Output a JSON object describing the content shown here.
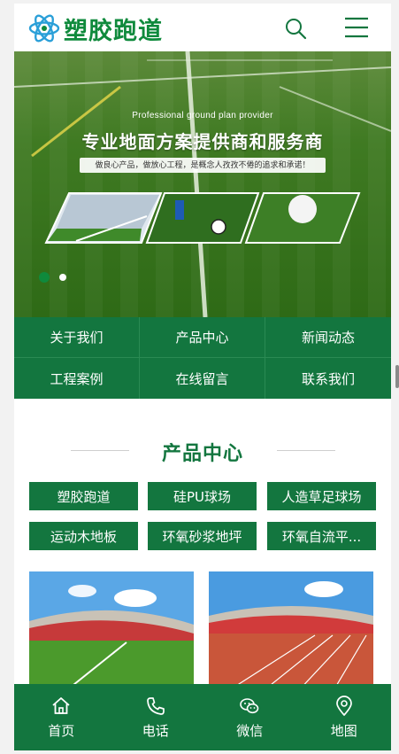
{
  "header": {
    "logo_text": "塑胶跑道",
    "search_icon": "search-icon",
    "menu_icon": "hamburger-menu-icon"
  },
  "banner": {
    "subtitle": "Professional ground plan provider",
    "title": "专业地面方案提供商和服务商",
    "slogan": "做良心产品，做放心工程，是概念人孜孜不倦的追求和承诺！",
    "active_slide": 1,
    "slide_count": 2
  },
  "nav": {
    "items": [
      {
        "label": "关于我们"
      },
      {
        "label": "产品中心"
      },
      {
        "label": "新闻动态"
      },
      {
        "label": "工程案例"
      },
      {
        "label": "在线留言"
      },
      {
        "label": "联系我们"
      }
    ]
  },
  "products": {
    "title": "产品中心",
    "categories": [
      {
        "label": "塑胶跑道"
      },
      {
        "label": "硅PU球场"
      },
      {
        "label": "人造草足球场"
      },
      {
        "label": "运动木地板"
      },
      {
        "label": "环氧砂浆地坪"
      },
      {
        "label": "环氧自流平..."
      }
    ]
  },
  "bottom_bar": {
    "items": [
      {
        "label": "首页",
        "icon": "home-icon"
      },
      {
        "label": "电话",
        "icon": "phone-icon"
      },
      {
        "label": "微信",
        "icon": "wechat-icon"
      },
      {
        "label": "地图",
        "icon": "map-pin-icon"
      }
    ]
  },
  "colors": {
    "brand_green": "#13763f",
    "logo_green": "#0f8a3c",
    "white": "#ffffff"
  }
}
